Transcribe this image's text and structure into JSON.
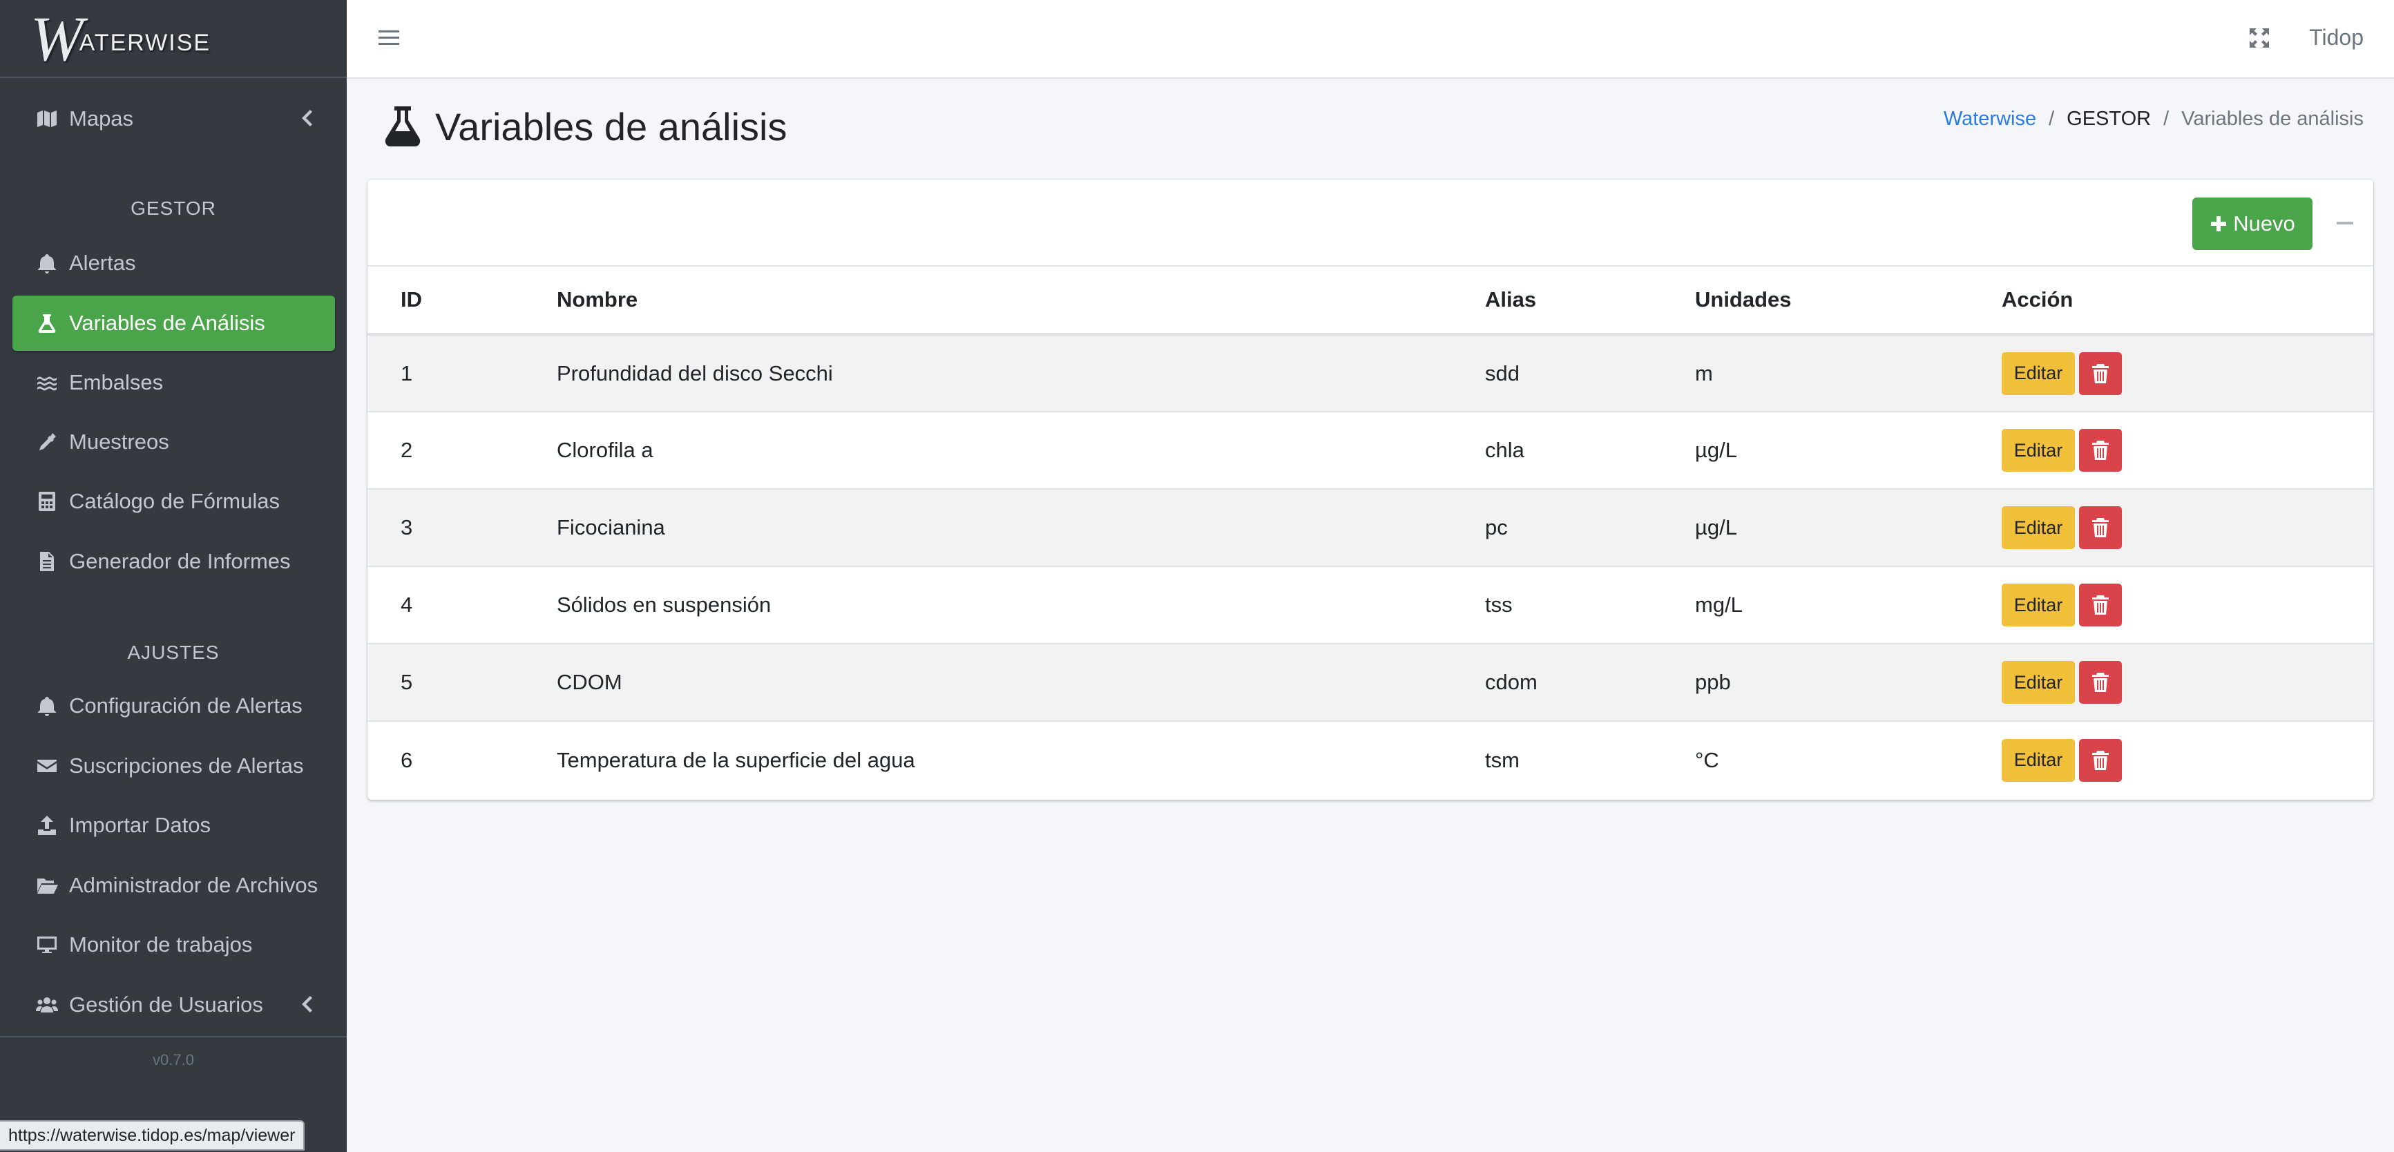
{
  "brand": {
    "mark": "W",
    "text": "ATERWISE"
  },
  "sidebar": {
    "maps": {
      "label": "Mapas",
      "icon": "map-icon"
    },
    "sections": [
      {
        "header": "GESTOR",
        "items": [
          {
            "label": "Alertas",
            "icon": "bell-icon"
          },
          {
            "label": "Variables de Análisis",
            "icon": "flask-icon",
            "active": true
          },
          {
            "label": "Embalses",
            "icon": "water-icon"
          },
          {
            "label": "Muestreos",
            "icon": "eyedropper-icon"
          },
          {
            "label": "Catálogo de Fórmulas",
            "icon": "calculator-icon"
          },
          {
            "label": "Generador de Informes",
            "icon": "file-icon"
          }
        ]
      },
      {
        "header": "AJUSTES",
        "items": [
          {
            "label": "Configuración de Alertas",
            "icon": "bell-icon"
          },
          {
            "label": "Suscripciones de Alertas",
            "icon": "envelope-icon"
          },
          {
            "label": "Importar Datos",
            "icon": "upload-icon"
          },
          {
            "label": "Administrador de Archivos",
            "icon": "folder-open-icon"
          },
          {
            "label": "Monitor de trabajos",
            "icon": "desktop-icon"
          },
          {
            "label": "Gestión de Usuarios",
            "icon": "users-icon"
          }
        ]
      }
    ],
    "version": "v0.7.0"
  },
  "topbar": {
    "user": "Tidop"
  },
  "page": {
    "title": "Variables de análisis",
    "breadcrumb": [
      "Waterwise",
      "GESTOR",
      "Variables de análisis"
    ]
  },
  "card": {
    "new_button": "Nuevo",
    "columns": [
      "ID",
      "Nombre",
      "Alias",
      "Unidades",
      "Acción"
    ],
    "edit_label": "Editar",
    "rows": [
      {
        "id": "1",
        "nombre": "Profundidad del disco Secchi",
        "alias": "sdd",
        "unidades": "m"
      },
      {
        "id": "2",
        "nombre": "Clorofila a",
        "alias": "chla",
        "unidades": "µg/L"
      },
      {
        "id": "3",
        "nombre": "Ficocianina",
        "alias": "pc",
        "unidades": "µg/L"
      },
      {
        "id": "4",
        "nombre": "Sólidos en suspensión",
        "alias": "tss",
        "unidades": "mg/L"
      },
      {
        "id": "5",
        "nombre": "CDOM",
        "alias": "cdom",
        "unidades": "ppb"
      },
      {
        "id": "6",
        "nombre": "Temperatura de la superficie del agua",
        "alias": "tsm",
        "unidades": "°C"
      }
    ]
  },
  "status_url": "https://waterwise.tidop.es/map/viewer",
  "colors": {
    "sidebar_bg": "#343a40",
    "active_green": "#4aa54a",
    "edit_yellow": "#f0c03a",
    "delete_red": "#d9434a",
    "link_blue": "#2c7be5"
  }
}
